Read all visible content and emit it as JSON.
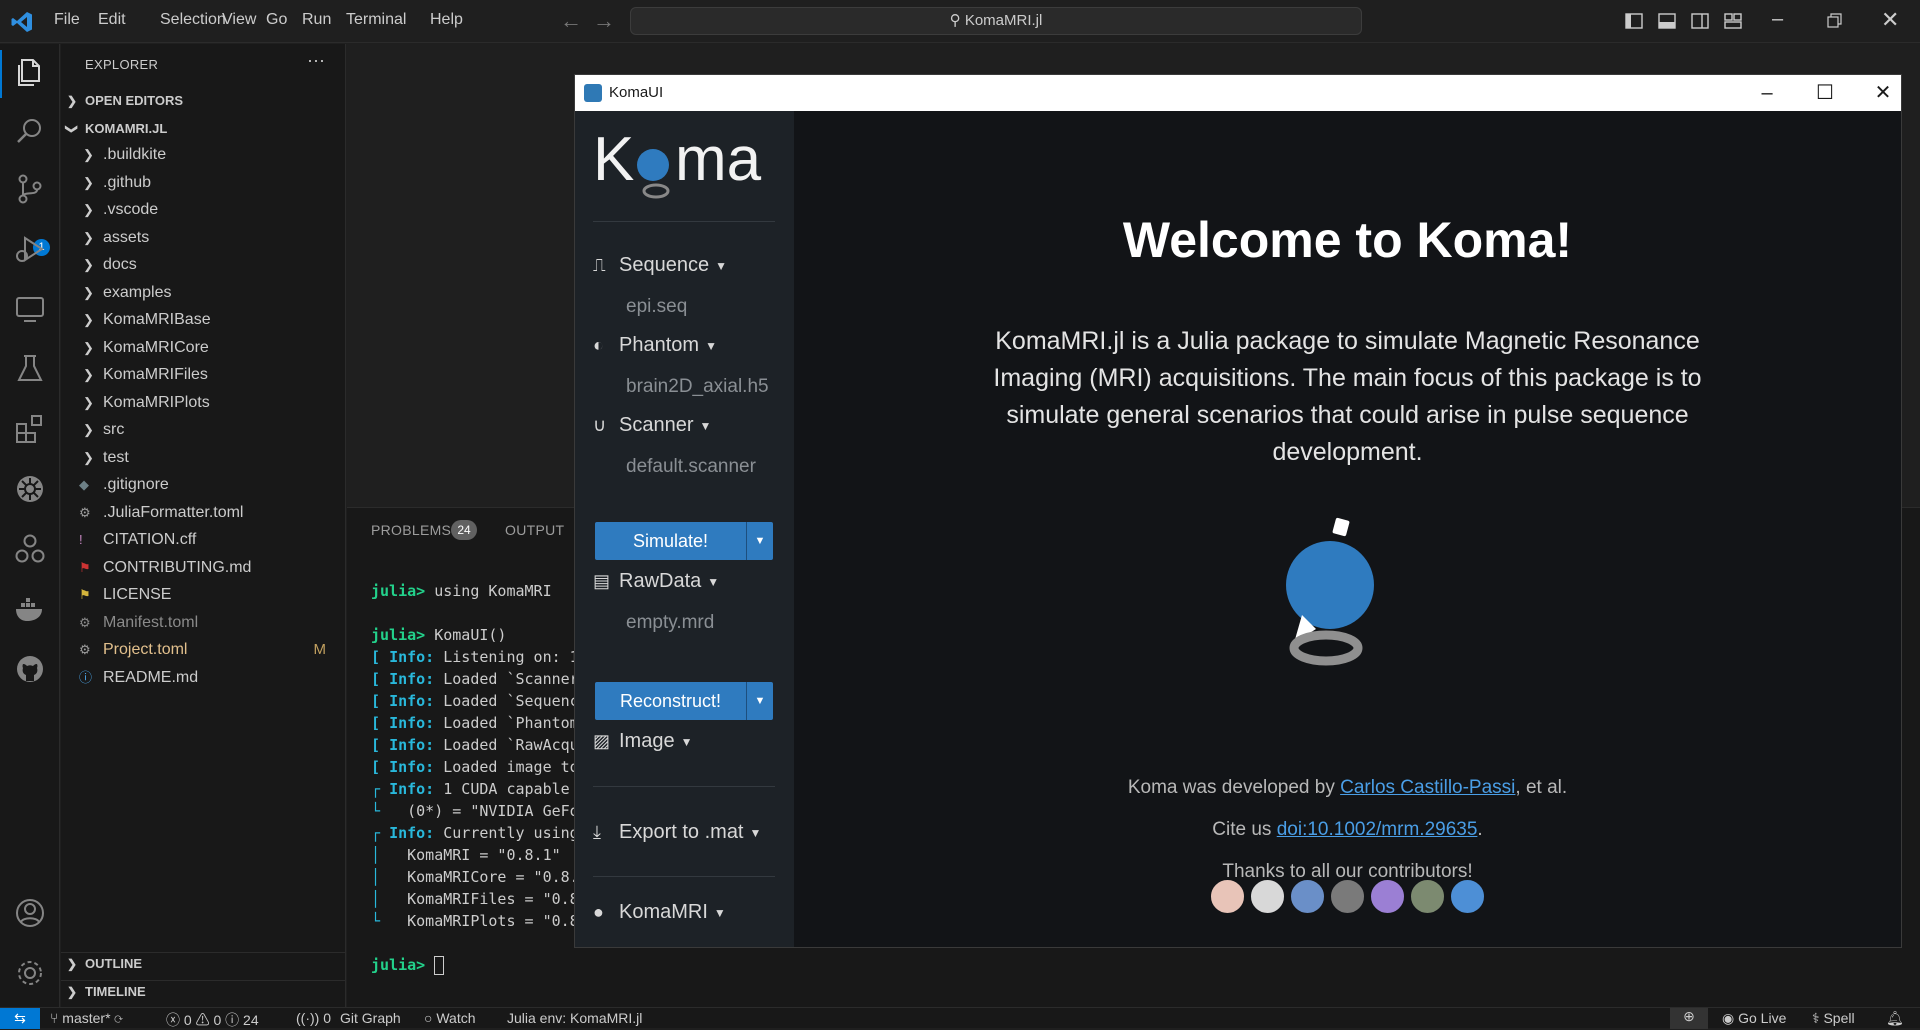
{
  "menu": [
    "File",
    "Edit",
    "Selection",
    "View",
    "Go",
    "Run",
    "Terminal",
    "Help"
  ],
  "search": {
    "text": "KomaMRI.jl"
  },
  "activity": {
    "scm_badge": "1"
  },
  "explorer": {
    "title": "EXPLORER",
    "open_editors": "OPEN EDITORS",
    "project": "KOMAMRI.JL",
    "folders": [
      ".buildkite",
      ".github",
      ".vscode",
      "assets",
      "docs",
      "examples",
      "KomaMRIBase",
      "KomaMRICore",
      "KomaMRIFiles",
      "KomaMRIPlots",
      "src",
      "test"
    ],
    "files": [
      {
        "name": ".gitignore",
        "icon": "diamond",
        "color": "#6d8086"
      },
      {
        "name": ".JuliaFormatter.toml",
        "icon": "gear",
        "color": "#9d9d9d"
      },
      {
        "name": "CITATION.cff",
        "icon": "exclamation",
        "color": "#c586c0"
      },
      {
        "name": "CONTRIBUTING.md",
        "icon": "ribbon",
        "color": "#c33"
      },
      {
        "name": "LICENSE",
        "icon": "ribbon",
        "color": "#d4b53c"
      },
      {
        "name": "Manifest.toml",
        "icon": "gear",
        "color": "#8a8a8a",
        "label_color": "#8a8a8a"
      },
      {
        "name": "Project.toml",
        "icon": "gear",
        "color": "#9d9d9d",
        "label_color": "#e2c08d",
        "status": "M"
      },
      {
        "name": "README.md",
        "icon": "info",
        "color": "#4aa3e6"
      }
    ],
    "outline": "OUTLINE",
    "timeline": "TIMELINE"
  },
  "panel": {
    "tabs": [
      "PROBLEMS",
      "OUTPUT"
    ],
    "problems_count": "24",
    "terminal": [
      {
        "prompt": "julia> ",
        "text": "using KomaMRI"
      },
      {
        "prompt": "",
        "text": ""
      },
      {
        "prompt": "julia> ",
        "text": "KomaUI()"
      },
      {
        "bracket": "[ ",
        "tag": "Info:",
        "text": " Listening on: 1"
      },
      {
        "bracket": "[ ",
        "tag": "Info:",
        "text": " Loaded `Scanner"
      },
      {
        "bracket": "[ ",
        "tag": "Info:",
        "text": " Loaded `Sequenc"
      },
      {
        "bracket": "[ ",
        "tag": "Info:",
        "text": " Loaded `Phantom"
      },
      {
        "bracket": "[ ",
        "tag": "Info:",
        "text": " Loaded `RawAcqu"
      },
      {
        "bracket": "[ ",
        "tag": "Info:",
        "text": " Loaded image to"
      },
      {
        "bracket": "┌ ",
        "tag": "Info:",
        "text": " 1 CUDA capable"
      },
      {
        "bracket": "└   ",
        "tag": "",
        "text": "(0*) = \"NVIDIA GeFo"
      },
      {
        "bracket": "┌ ",
        "tag": "Info:",
        "text": " Currently using"
      },
      {
        "bracket": "│   ",
        "tag": "",
        "text": "KomaMRI = \"0.8.1\""
      },
      {
        "bracket": "│   ",
        "tag": "",
        "text": "KomaMRICore = \"0.8."
      },
      {
        "bracket": "│   ",
        "tag": "",
        "text": "KomaMRIFiles = \"0.8"
      },
      {
        "bracket": "└   ",
        "tag": "",
        "text": "KomaMRIPlots = \"0.8"
      },
      {
        "prompt": "",
        "text": ""
      },
      {
        "prompt": "julia> ",
        "text": ""
      }
    ]
  },
  "status": {
    "branch": "master*",
    "errors": "0",
    "warnings": "0",
    "infos": "24",
    "ports": "0",
    "git_graph": "Git Graph",
    "watch": "Watch",
    "julia_env": "Julia env: KomaMRI.jl",
    "go_live": "Go Live",
    "spell": "Spell"
  },
  "koma": {
    "window_title": "KomaUI",
    "logo_text": "Koma",
    "sequence": {
      "label": "Sequence",
      "file": "epi.seq"
    },
    "phantom": {
      "label": "Phantom",
      "file": "brain2D_axial.h5"
    },
    "scanner": {
      "label": "Scanner",
      "file": "default.scanner"
    },
    "simulate": "Simulate!",
    "rawdata": {
      "label": "RawData",
      "file": "empty.mrd"
    },
    "reconstruct": "Reconstruct!",
    "image": "Image",
    "export": "Export to .mat",
    "github": "KomaMRI",
    "welcome": "Welcome to Koma!",
    "intro": "KomaMRI.jl is a Julia package to simulate Magnetic Resonance Imaging (MRI) acquisitions. The main focus of this package is to simulate general scenarios that could arise in pulse sequence development.",
    "dev_prefix": "Koma was developed by ",
    "dev_name": "Carlos Castillo-Passi",
    "dev_suffix": ", et al.",
    "cite_prefix": "Cite us ",
    "cite_doi": "doi:10.1002/mrm.29635",
    "cite_suffix": ".",
    "thanks": "Thanks to all our contributors!",
    "contributor_colors": [
      "#e8c4b8",
      "#d8d8d8",
      "#6a8fc8",
      "#7a7a7a",
      "#9b7fd4",
      "#7c8a70",
      "#4d8fd6"
    ]
  }
}
